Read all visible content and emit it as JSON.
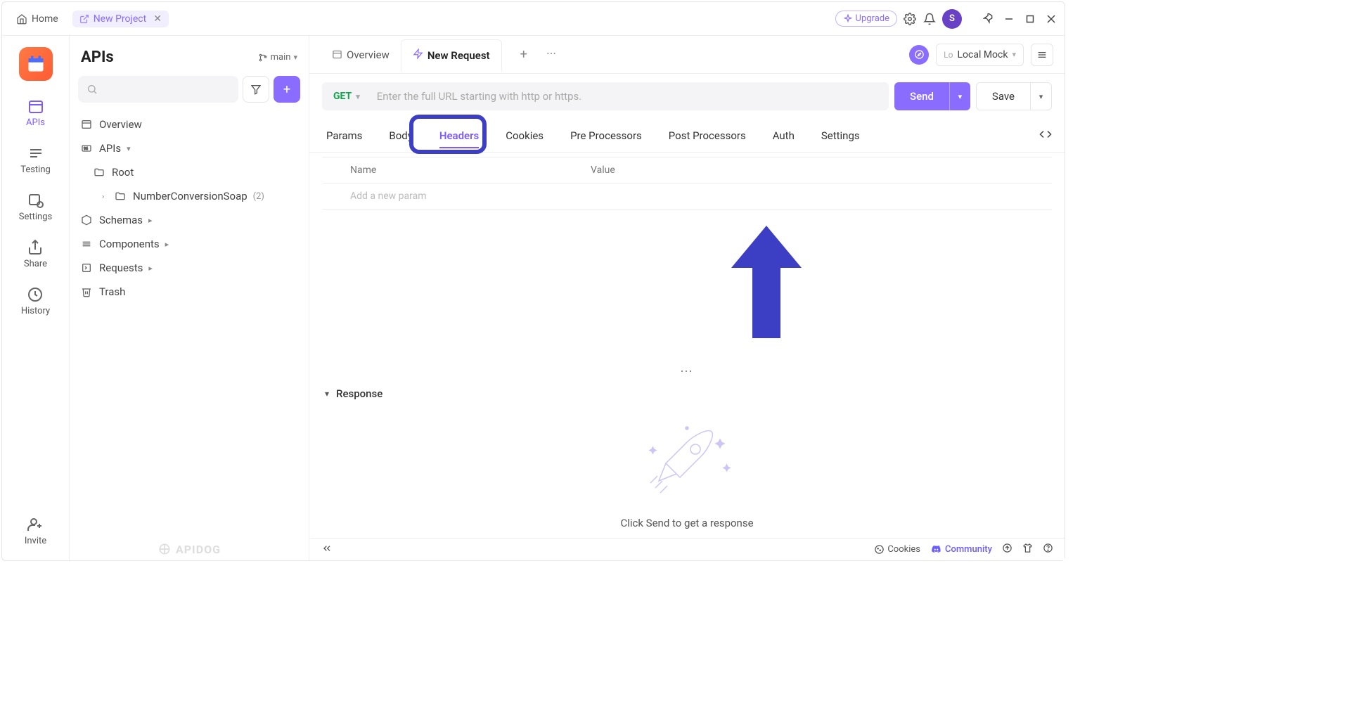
{
  "titlebar": {
    "home_label": "Home",
    "project_label": "New Project",
    "upgrade_label": "Upgrade",
    "avatar_letter": "S"
  },
  "left_rail": {
    "items": [
      {
        "label": "APIs"
      },
      {
        "label": "Testing"
      },
      {
        "label": "Settings"
      },
      {
        "label": "Share"
      },
      {
        "label": "History"
      },
      {
        "label": "Invite"
      }
    ]
  },
  "sidebar": {
    "title": "APIs",
    "branch": "main",
    "tree": {
      "overview": "Overview",
      "apis": "APIs",
      "root": "Root",
      "folder_name": "NumberConversionSoap",
      "folder_count": "(2)",
      "schemas": "Schemas",
      "components": "Components",
      "requests": "Requests",
      "trash": "Trash"
    },
    "brand": "APIDOG"
  },
  "content_tabs": {
    "overview": "Overview",
    "new_request": "New Request",
    "env_prefix": "Lo",
    "env_name": "Local Mock"
  },
  "request": {
    "method": "GET",
    "url_placeholder": "Enter the full URL starting with http or https.",
    "send": "Send",
    "save": "Save"
  },
  "subtabs": {
    "params": "Params",
    "body": "Body",
    "headers": "Headers",
    "cookies": "Cookies",
    "pre": "Pre Processors",
    "post": "Post Processors",
    "auth": "Auth",
    "settings": "Settings"
  },
  "table": {
    "name_col": "Name",
    "value_col": "Value",
    "new_param_placeholder": "Add a new param"
  },
  "response": {
    "heading": "Response",
    "empty_hint": "Click Send to get a response"
  },
  "bottom": {
    "cookies": "Cookies",
    "community": "Community"
  }
}
